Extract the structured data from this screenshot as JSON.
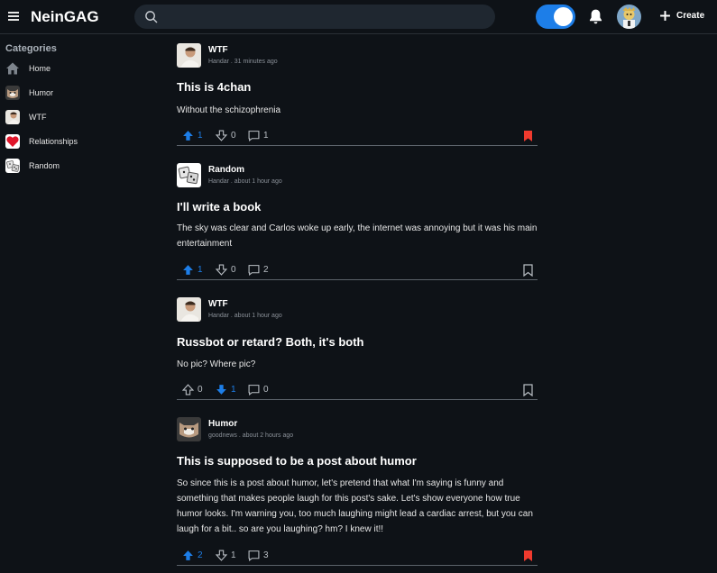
{
  "header": {
    "logo": "NeinGAG",
    "search_placeholder": "",
    "create_label": "Create",
    "accent_color": "#1d7ee8"
  },
  "sidebar": {
    "title": "Categories",
    "items": [
      {
        "label": "Home",
        "icon": "home-icon"
      },
      {
        "label": "Humor",
        "icon": "cat-icon"
      },
      {
        "label": "WTF",
        "icon": "man-icon"
      },
      {
        "label": "Relationships",
        "icon": "heart-icon"
      },
      {
        "label": "Random",
        "icon": "dice-icon"
      }
    ]
  },
  "posts": [
    {
      "category": "WTF",
      "meta": "Handar . 31 minutes ago",
      "title": "This is 4chan",
      "body": "Without the schizophrenia",
      "upvotes": "1",
      "downvotes": "0",
      "comments": "1",
      "vote": "up",
      "bookmarked": true
    },
    {
      "category": "Random",
      "meta": "Handar . about 1 hour ago",
      "title": "I'll write a book",
      "body": "The sky was clear and Carlos woke up early, the internet was annoying but it was his main entertainment",
      "upvotes": "1",
      "downvotes": "0",
      "comments": "2",
      "vote": "up",
      "bookmarked": false
    },
    {
      "category": "WTF",
      "meta": "Handar . about 1 hour ago",
      "title": "Russbot or retard? Both, it's both",
      "body": "No pic? Where pic?",
      "upvotes": "0",
      "downvotes": "1",
      "comments": "0",
      "vote": "down",
      "bookmarked": false
    },
    {
      "category": "Humor",
      "meta": "goodnews . about 2 hours ago",
      "title": "This is supposed to be a post about humor",
      "body": "So since this is a post about humor, let's pretend that what I'm saying is funny and something that makes people laugh for this post's sake. Let's show everyone how true humor looks. I'm warning you, too much laughing might lead a cardiac arrest, but you can laugh for a bit.. so are you laughing? hm? I knew it!!",
      "upvotes": "2",
      "downvotes": "1",
      "comments": "3",
      "vote": "up",
      "bookmarked": true
    }
  ]
}
